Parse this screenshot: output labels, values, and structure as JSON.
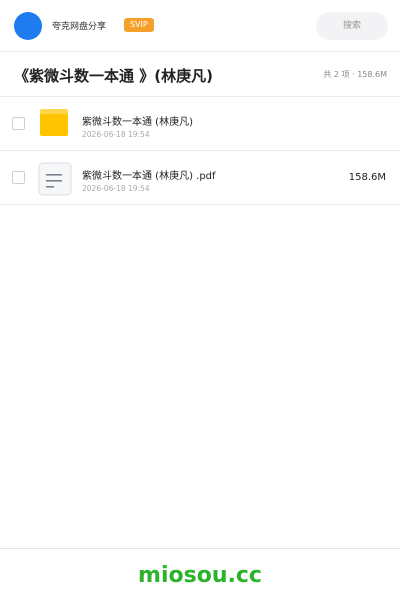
{
  "header": {
    "username": "夸克网盘分享",
    "badge": "SVIP",
    "search_placeholder": "搜索"
  },
  "folder": {
    "title": "《紫微斗数一本通 》(林庚凡)",
    "summary": "共 2 项 · 158.6M"
  },
  "files": [
    {
      "name": "紫微斗数一本通 (林庚凡)",
      "date": "2026-06-18 19:54",
      "size": "",
      "icon": "folder-icon"
    },
    {
      "name": "紫微斗数一本通 (林庚凡) .pdf",
      "date": "2026-06-18 19:54",
      "size": "158.6M",
      "icon": "document-icon"
    }
  ],
  "footer": {
    "watermark": "miosou.cc"
  },
  "colors": {
    "accent": "#1e7bf0",
    "svip": "#f5a02a",
    "folder": "#ffc400",
    "watermark": "#2bb32b"
  }
}
